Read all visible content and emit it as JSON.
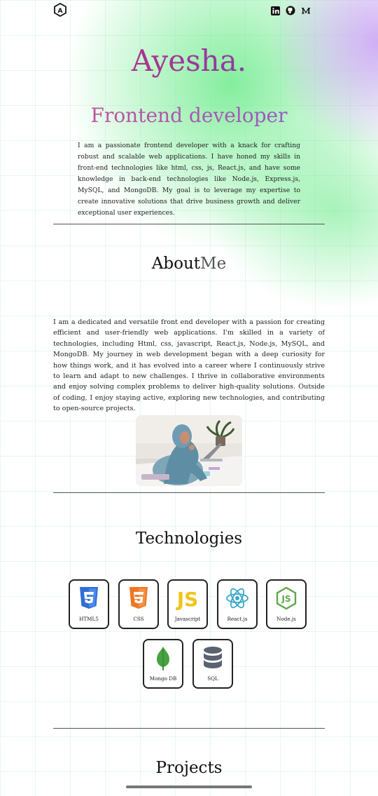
{
  "header": {
    "logo_letter": "A",
    "social_icons": [
      "linkedin-icon",
      "github-icon",
      "medium-icon"
    ]
  },
  "hero": {
    "name": "Ayesha.",
    "role": "Frontend developer",
    "description": "I am a passionate frontend developer with a knack for crafting robust and scalable web applications. I have honed my skills in front-end technologies like html, css, js, React.js, and have some knowledge in back-end technologies like Node.js, Express.js, MySQL, and MongoDB. My goal is to leverage my expertise to create innovative solutions that drive business growth and deliver exceptional user experiences."
  },
  "about": {
    "title_main": "About",
    "title_accent": "Me",
    "text": "I am a dedicated and versatile front end developer with a passion for creating efficient and user-friendly web applications. I'm skilled in a variety of technologies, including Html, css, javascript, React.js, Node.js, MySQL, and MongoDB. My journey in web development began with a deep curiosity for how things work, and it has evolved into a career where I continuously strive to learn and adapt to new challenges. I thrive in collaborative environments and enjoy solving complex problems to deliver high-quality solutions. Outside of coding, I enjoy staying active, exploring new technologies, and contributing to open-source projects."
  },
  "technologies": {
    "title": "Technologies",
    "items": [
      {
        "label": "HTML5",
        "icon": "html5-icon",
        "color": "#2f6fd6"
      },
      {
        "label": "CSS",
        "icon": "css-icon",
        "color": "#ee7722"
      },
      {
        "label": "Javascript",
        "icon": "javascript-icon",
        "color": "#f0c419"
      },
      {
        "label": "React.js",
        "icon": "react-icon",
        "color": "#3aa8c8"
      },
      {
        "label": "Node.js",
        "icon": "nodejs-icon",
        "color": "#5ea84a"
      },
      {
        "label": "Mongo DB",
        "icon": "mongodb-icon",
        "color": "#47a23f"
      },
      {
        "label": "SQL",
        "icon": "sql-icon",
        "color": "#5a6270"
      }
    ]
  },
  "projects": {
    "title": "Projects"
  }
}
